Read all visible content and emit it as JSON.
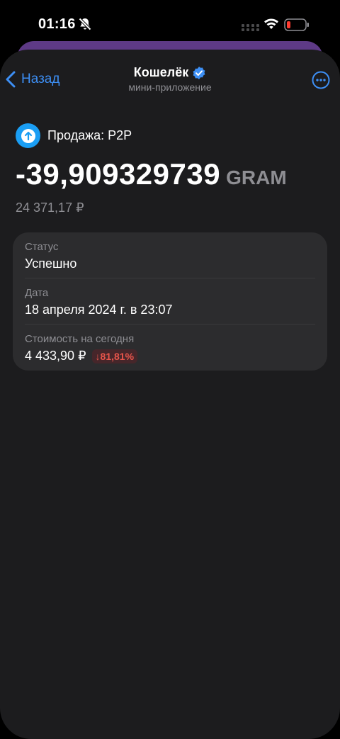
{
  "status_bar": {
    "time": "01:16"
  },
  "header": {
    "back_label": "Назад",
    "title": "Кошелёк",
    "subtitle": "мини-приложение"
  },
  "transaction": {
    "type_label": "Продажа: P2P",
    "amount": "-39,909329739",
    "currency": "GRAM",
    "fiat_value": "24 371,17 ₽"
  },
  "details": {
    "status_label": "Статус",
    "status_value": "Успешно",
    "date_label": "Дата",
    "date_value": "18 апреля 2024 г. в 23:07",
    "value_today_label": "Стоимость на сегодня",
    "value_today": "4 433,90 ₽",
    "change": "↓81,81%"
  },
  "colors": {
    "accent": "#3d8ff5",
    "sheet_bg": "#1c1c1e",
    "card_bg": "#2c2c2e",
    "negative": "#e8554b",
    "tx_icon": "#1a9ef4"
  },
  "icons": [
    "bell-slash-icon",
    "signal-icon",
    "wifi-icon",
    "battery-icon",
    "chevron-left-icon",
    "verified-icon",
    "more-icon",
    "arrow-up-icon"
  ]
}
